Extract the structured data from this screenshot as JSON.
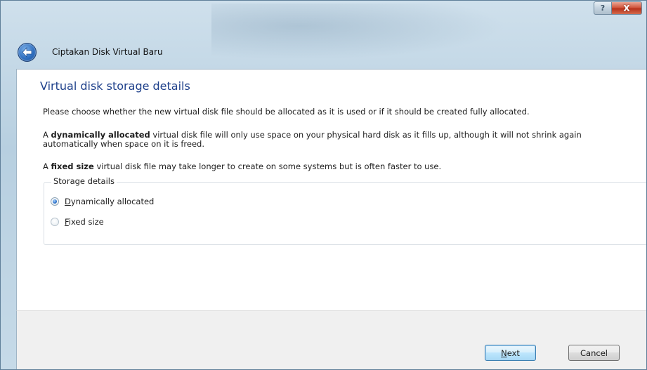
{
  "window": {
    "title": "Ciptakan Disk Virtual Baru",
    "help_glyph": "?",
    "close_glyph": "X"
  },
  "page": {
    "heading": "Virtual disk storage details",
    "intro": "Please choose whether the new virtual disk file should be allocated as it is used or if it should be created fully allocated.",
    "dynamic_para": {
      "prefix": "A ",
      "bold": "dynamically allocated",
      "rest": " virtual disk file will only use space on your physical hard disk as it fills up, although it will not shrink again automatically when space on it is freed."
    },
    "fixed_para": {
      "prefix": "A ",
      "bold": "fixed size",
      "rest": " virtual disk file may take longer to create on some systems but is often faster to use."
    }
  },
  "storage_group": {
    "title": "Storage details",
    "options": [
      {
        "mnemonic": "D",
        "rest": "ynamically allocated",
        "checked": true
      },
      {
        "mnemonic": "F",
        "rest": "ixed size",
        "checked": false
      }
    ]
  },
  "footer": {
    "next": {
      "mnemonic": "N",
      "rest": "ext"
    },
    "cancel_label": "Cancel"
  },
  "colors": {
    "heading": "#1d3f8a",
    "frame": "#b7cfe0",
    "close_button": "#c8462c",
    "default_button_border": "#3c7fb1"
  },
  "icons": {
    "back": "back-arrow-icon",
    "help": "help-icon",
    "close": "close-icon",
    "radio_checked": "radio-checked-icon",
    "radio_unchecked": "radio-unchecked-icon"
  }
}
